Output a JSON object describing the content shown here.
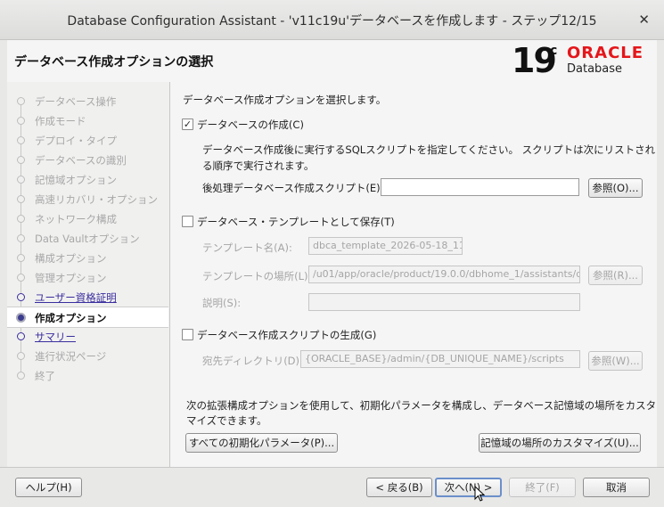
{
  "window": {
    "title": "Database Configuration Assistant - 'v11c19u'データベースを作成します - ステップ12/15",
    "close_glyph": "✕"
  },
  "header": {
    "title": "データベース作成オプションの選択",
    "logo": {
      "version": "19",
      "suffix": "c",
      "brand": "ORACLE",
      "product": "Database",
      "brand_color": "#e4161b"
    }
  },
  "nav": {
    "items": [
      {
        "label": "データベース操作",
        "state": "disabled"
      },
      {
        "label": "作成モード",
        "state": "disabled"
      },
      {
        "label": "デプロイ・タイプ",
        "state": "disabled"
      },
      {
        "label": "データベースの識別",
        "state": "disabled"
      },
      {
        "label": "記憶域オプション",
        "state": "disabled"
      },
      {
        "label": "高速リカバリ・オプション",
        "state": "disabled"
      },
      {
        "label": "ネットワーク構成",
        "state": "disabled"
      },
      {
        "label": "Data Vaultオプション",
        "state": "disabled"
      },
      {
        "label": "構成オプション",
        "state": "disabled"
      },
      {
        "label": "管理オプション",
        "state": "disabled"
      },
      {
        "label": "ユーザー資格証明",
        "state": "link"
      },
      {
        "label": "作成オプション",
        "state": "current"
      },
      {
        "label": "サマリー",
        "state": "link"
      },
      {
        "label": "進行状況ページ",
        "state": "disabled"
      },
      {
        "label": "終了",
        "state": "disabled"
      }
    ]
  },
  "main": {
    "intro": "データベース作成オプションを選択します。",
    "create_db": {
      "label": "データベースの作成(C)",
      "checked": true,
      "check_glyph": "✓",
      "desc_line1": "データベース作成後に実行するSQLスクリプトを指定してください。 スクリプトは次にリストされ",
      "desc_line2": "る順序で実行されます。",
      "script_label": "後処理データベース作成スクリプト(E):",
      "script_value": "",
      "browse": "参照(O)..."
    },
    "save_template": {
      "label": "データベース・テンプレートとして保存(T)",
      "checked": false,
      "name_label": "テンプレート名(A):",
      "name_value": "dbca_template_2026-05-18_11-",
      "location_label": "テンプレートの場所(L):",
      "location_value": "/u01/app/oracle/product/19.0.0/dbhome_1/assistants/dbca",
      "browse": "参照(R)...",
      "desc_label": "説明(S):",
      "desc_value": ""
    },
    "gen_scripts": {
      "label": "データベース作成スクリプトの生成(G)",
      "checked": false,
      "dest_label": "宛先ディレクトリ(D):",
      "dest_value": "{ORACLE_BASE}/admin/{DB_UNIQUE_NAME}/scripts",
      "browse": "参照(W)..."
    },
    "advanced": {
      "line1": "次の拡張構成オプションを使用して、初期化パラメータを構成し、データベース記憶域の場所をカスタ",
      "line2": "マイズできます。",
      "init_params": "すべての初期化パラメータ(P)...",
      "storage_loc": "記憶域の場所のカスタマイズ(U)..."
    }
  },
  "footer": {
    "help": "ヘルプ(H)",
    "back": "< 戻る(B)",
    "next": "次へ(N) >",
    "finish": "終了(F)",
    "cancel": "取消"
  }
}
